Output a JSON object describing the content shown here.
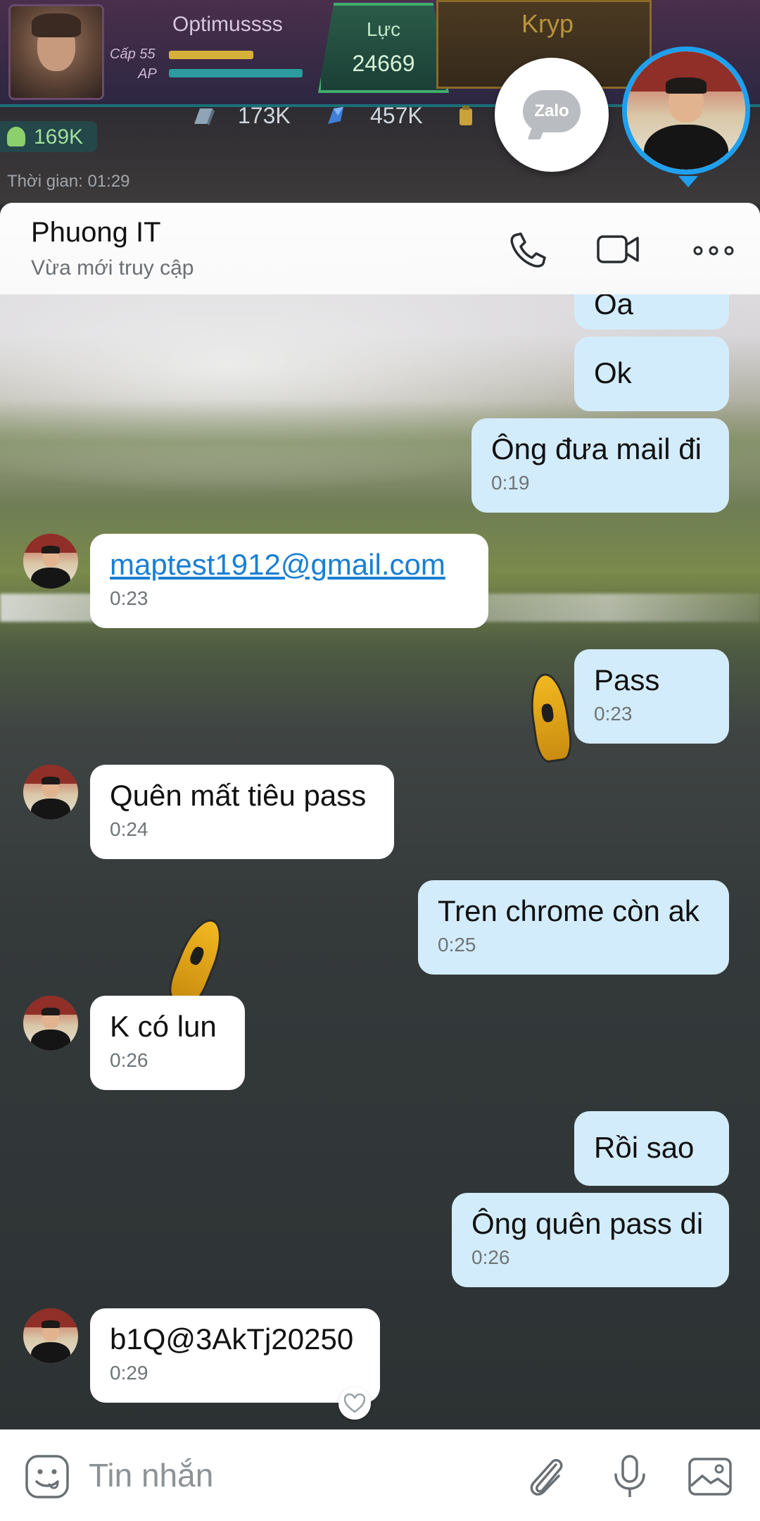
{
  "game_hud": {
    "player_name": "Optimussss",
    "level_label": "Cấp 55",
    "ap_label": "AP",
    "power_label": "Lực",
    "power_value": "24669",
    "kryp_label": "Kryp",
    "resource_1": "173K",
    "resource_2": "457K",
    "followers": "169K",
    "timer": "Thời gian: 01:29"
  },
  "chat_heads": {
    "zalo_label": "Zalo"
  },
  "chat": {
    "contact_name": "Phuong IT",
    "contact_status": "Vừa mới truy cập",
    "messages": [
      {
        "side": "sent",
        "text": "Oa",
        "time": ""
      },
      {
        "side": "sent",
        "text": "Ok",
        "time": ""
      },
      {
        "side": "sent",
        "text": "Ông đưa mail đi",
        "time": "0:19"
      },
      {
        "side": "recv",
        "text": "maptest1912@gmail.com",
        "time": "0:23"
      },
      {
        "side": "sent",
        "text": "Pass",
        "time": "0:23"
      },
      {
        "side": "recv",
        "text": "Quên mất tiêu pass",
        "time": "0:24"
      },
      {
        "side": "sent",
        "text": "Tren chrome còn ak",
        "time": "0:25"
      },
      {
        "side": "recv",
        "text": "K có lun",
        "time": "0:26"
      },
      {
        "side": "sent",
        "text": "Rồi sao",
        "time": ""
      },
      {
        "side": "sent",
        "text": "Ông quên pass di",
        "time": "0:26"
      },
      {
        "side": "recv",
        "text": "b1Q@3AkTj20250",
        "time": "0:29"
      }
    ]
  },
  "input": {
    "placeholder": "Tin nhắn"
  },
  "colors": {
    "sent_bubble": "#d3ecfb",
    "received_bubble": "#ffffff",
    "link": "#1a7fd3",
    "chat_head_ring": "#1fa0ef"
  },
  "icons": [
    "phone-icon",
    "video-call-icon",
    "more-options-icon",
    "sticker-icon",
    "attach-icon",
    "microphone-icon",
    "image-icon",
    "heart-icon"
  ]
}
